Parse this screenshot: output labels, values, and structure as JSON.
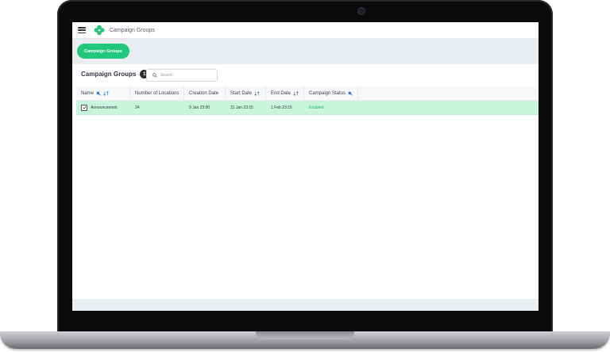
{
  "app": {
    "title": "Campaign Groups",
    "brand_color": "#21c77a"
  },
  "toolbar": {
    "primary_tab_label": "Campaign Groups"
  },
  "section": {
    "title": "Campaign Groups",
    "count": "1"
  },
  "search": {
    "placeholder": "Search",
    "value": ""
  },
  "table": {
    "columns": [
      {
        "label": "Name",
        "icons": [
          "search-icon",
          "sort-icon"
        ]
      },
      {
        "label": "Number of Locations",
        "icons": []
      },
      {
        "label": "Creation Date",
        "icons": []
      },
      {
        "label": "Start Date",
        "icons": [
          "sort-icon"
        ]
      },
      {
        "label": "End Date",
        "icons": [
          "sort-icon"
        ]
      },
      {
        "label": "Campaign Status",
        "icons": [
          "search-icon"
        ]
      }
    ],
    "rows": [
      {
        "name": "Announcement",
        "locations": "24",
        "creation_date": "9 Jan 23:00",
        "start_date": "31 Jan 23:15",
        "end_date": "1 Feb 23:15",
        "status": "Enabled",
        "checked": true
      }
    ],
    "row_highlight_color": "#c9f5dd",
    "status_color": "#1fb96d"
  }
}
